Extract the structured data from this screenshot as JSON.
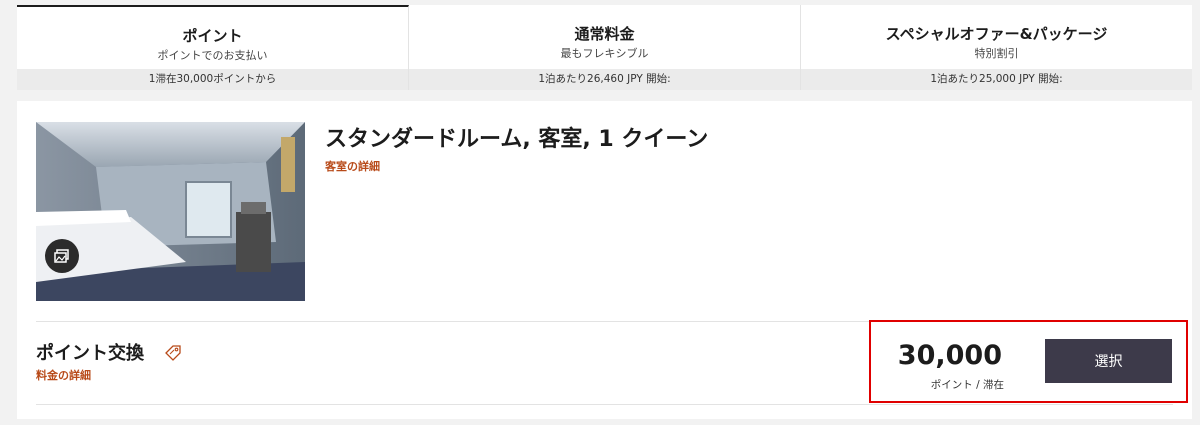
{
  "tabs": [
    {
      "title": "ポイント",
      "subtitle": "ポイントでのお支払い",
      "price": "1滞在30,000ポイントから"
    },
    {
      "title": "通常料金",
      "subtitle": "最もフレキシブル",
      "price": "1泊あたり26,460 JPY 開始:"
    },
    {
      "title": "スペシャルオファー&パッケージ",
      "subtitle": "特別割引",
      "price": "1泊あたり25,000 JPY 開始:"
    }
  ],
  "room": {
    "title": "スタンダードルーム, 客室, 1 クイーン",
    "details_link": "客室の詳細",
    "photo_icon": "gallery-icon"
  },
  "rate": {
    "title": "ポイント交換",
    "icon": "tag-icon",
    "details_link": "料金の詳細",
    "price": "30,000",
    "unit": "ポイント / 滞在",
    "select_label": "選択"
  },
  "colors": {
    "accent_link": "#b84a19",
    "button_bg": "#3d3a4a",
    "highlight_border": "#e00000"
  }
}
